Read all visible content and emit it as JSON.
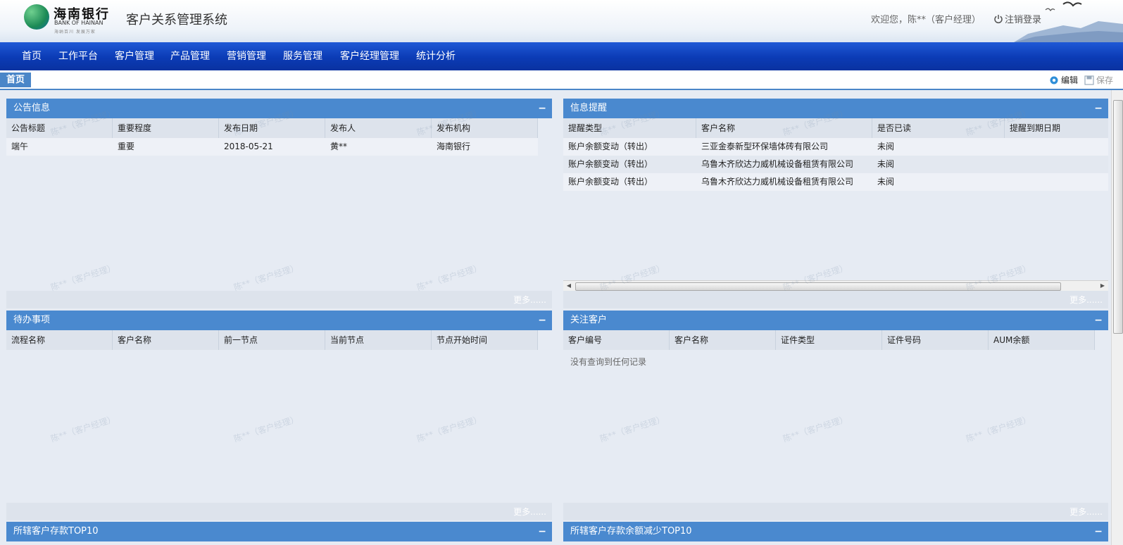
{
  "header": {
    "bank_name": "海南银行",
    "bank_name_en": "BANK OF HAINAN",
    "slogan": "海纳百川   发展万家",
    "system_title": "客户关系管理系统",
    "welcome": "欢迎您，陈**（客户经理）",
    "logout_label": "注销登录"
  },
  "nav": {
    "items": [
      "首页",
      "工作平台",
      "客户管理",
      "产品管理",
      "营销管理",
      "服务管理",
      "客户经理管理",
      "统计分析"
    ]
  },
  "tabbar": {
    "active_tab": "首页",
    "edit_label": "编辑",
    "save_label": "保存"
  },
  "watermark": "陈**（客户经理）",
  "panels": {
    "announcements": {
      "title": "公告信息",
      "collapse": "−",
      "columns": [
        "公告标题",
        "重要程度",
        "发布日期",
        "发布人",
        "发布机构"
      ],
      "rows": [
        [
          "端午",
          "重要",
          "2018-05-21",
          "黄**",
          "海南银行"
        ]
      ],
      "more": "更多......"
    },
    "reminders": {
      "title": "信息提醒",
      "collapse": "−",
      "columns": [
        "提醒类型",
        "客户名称",
        "是否已读",
        "提醒到期日期"
      ],
      "rows": [
        [
          "账户余额变动（转出）",
          "三亚金泰新型环保墙体砖有限公司",
          "未阅",
          ""
        ],
        [
          "账户余额变动（转出）",
          "乌鲁木齐欣达力威机械设备租赁有限公司",
          "未阅",
          ""
        ],
        [
          "账户余额变动（转出）",
          "乌鲁木齐欣达力威机械设备租赁有限公司",
          "未阅",
          ""
        ]
      ],
      "more": "更多......"
    },
    "todo": {
      "title": "待办事项",
      "collapse": "−",
      "columns": [
        "流程名称",
        "客户名称",
        "前一节点",
        "当前节点",
        "节点开始时间"
      ],
      "more": "更多......"
    },
    "followed": {
      "title": "关注客户",
      "collapse": "−",
      "columns": [
        "客户编号",
        "客户名称",
        "证件类型",
        "证件号码",
        "AUM余额"
      ],
      "empty_text": "没有查询到任何记录",
      "more": "更多......"
    },
    "deposit_top10": {
      "title": "所辖客户存款TOP10",
      "collapse": "−"
    },
    "decrease_top10": {
      "title": "所辖客户存款余额减少TOP10",
      "collapse": "−"
    }
  },
  "colors": {
    "nav_blue": "#0b3bb5",
    "panel_header": "#4a89cf",
    "background": "#e6ebf3"
  }
}
